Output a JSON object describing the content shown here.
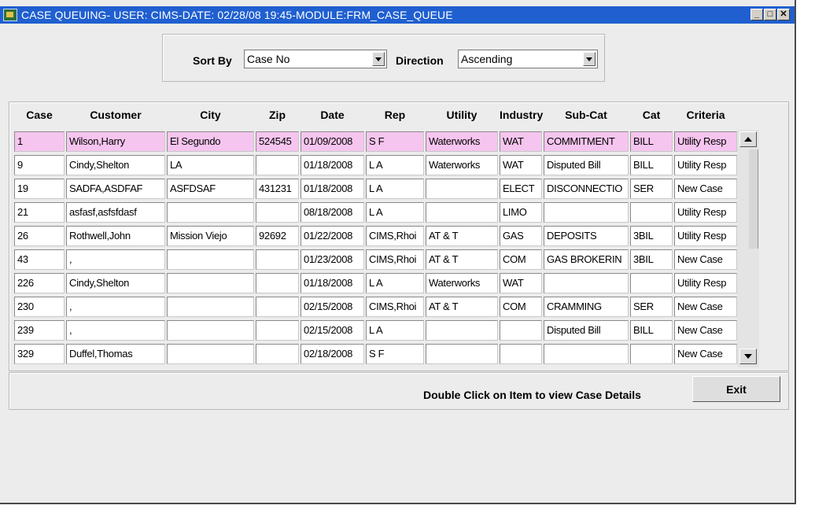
{
  "window": {
    "title": "CASE QUEUING- USER: CIMS-DATE: 02/28/08 19:45-MODULE:FRM_CASE_QUEUE",
    "controls": [
      "minimize-icon",
      "maximize-icon",
      "close-icon"
    ]
  },
  "sort": {
    "sort_by_label": "Sort By",
    "sort_by_value": "Case No",
    "direction_label": "Direction",
    "direction_value": "Ascending"
  },
  "table": {
    "headers": [
      "Case",
      "Customer",
      "City",
      "Zip",
      "Date",
      "Rep",
      "Utility",
      "Industry",
      "Sub-Cat",
      "Cat",
      "Criteria"
    ],
    "rows": [
      [
        "1",
        "Wilson,Harry",
        "El Segundo",
        "524545",
        "01/09/2008",
        "S F",
        "Waterworks",
        "WAT",
        "COMMITMENT",
        "BILL",
        "Utility Resp"
      ],
      [
        "9",
        "Cindy,Shelton",
        "LA",
        "",
        "01/18/2008",
        "L A",
        "Waterworks",
        "WAT",
        "Disputed Bill",
        "BILL",
        "Utility Resp"
      ],
      [
        "19",
        "SADFA,ASDFAF",
        "ASFDSAF",
        "431231",
        "01/18/2008",
        "L A",
        "",
        "ELECT",
        "DISCONNECTIO",
        "SER",
        "New Case"
      ],
      [
        "21",
        "asfasf,asfsfdasf",
        "",
        "",
        "08/18/2008",
        "L A",
        "",
        "LIMO",
        "",
        "",
        "Utility Resp"
      ],
      [
        "26",
        "Rothwell,John",
        "Mission Viejo",
        "92692",
        "01/22/2008",
        "CIMS,Rhoi",
        "AT & T",
        "GAS",
        "DEPOSITS",
        "3BIL",
        "Utility Resp"
      ],
      [
        "43",
        ",",
        "",
        "",
        "01/23/2008",
        "CIMS,Rhoi",
        "AT & T",
        "COM",
        "GAS BROKERIN",
        "3BIL",
        "New Case"
      ],
      [
        "226",
        "Cindy,Shelton",
        "",
        "",
        "01/18/2008",
        "L A",
        "Waterworks",
        "WAT",
        "",
        "",
        "Utility Resp"
      ],
      [
        "230",
        ",",
        "",
        "",
        "02/15/2008",
        "CIMS,Rhoi",
        "AT & T",
        "COM",
        "CRAMMING",
        "SER",
        "New Case"
      ],
      [
        "239",
        ",",
        "",
        "",
        "02/15/2008",
        "L A",
        "",
        "",
        "Disputed Bill",
        "BILL",
        "New Case"
      ],
      [
        "329",
        "Duffel,Thomas",
        "",
        "",
        "02/18/2008",
        "S F",
        "",
        "",
        "",
        "",
        "New Case"
      ]
    ]
  },
  "footer": {
    "hint": "Double Click on Item to view Case Details",
    "exit_label": "Exit"
  }
}
